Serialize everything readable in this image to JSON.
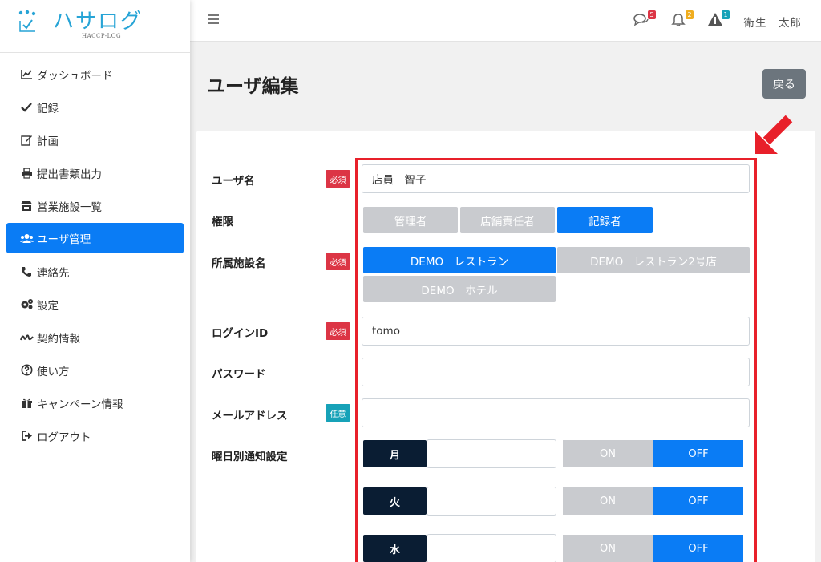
{
  "brand": {
    "title": "ハサログ",
    "subtitle": "HACCP-LOG"
  },
  "sidebar": {
    "items": [
      {
        "label": "ダッシュボード",
        "icon": "chart-line-icon"
      },
      {
        "label": "記録",
        "icon": "check-icon"
      },
      {
        "label": "計画",
        "icon": "edit-icon"
      },
      {
        "label": "提出書類出力",
        "icon": "printer-icon"
      },
      {
        "label": "営業施設一覧",
        "icon": "store-icon"
      },
      {
        "label": "ユーザ管理",
        "icon": "users-icon",
        "active": true
      },
      {
        "label": "連絡先",
        "icon": "phone-icon"
      },
      {
        "label": "設定",
        "icon": "gears-icon"
      },
      {
        "label": "契約情報",
        "icon": "signature-icon"
      },
      {
        "label": "使い方",
        "icon": "question-circle-icon"
      },
      {
        "label": "キャンペーン情報",
        "icon": "gift-icon"
      },
      {
        "label": "ログアウト",
        "icon": "sign-out-icon"
      }
    ]
  },
  "topbar": {
    "messages_badge": "5",
    "notifications_badge": "2",
    "alerts_badge": "1",
    "user_name": "衛生　太郎",
    "colors": {
      "red": "#dc3545",
      "yellow": "#f0ad1e",
      "teal": "#17a2b8"
    }
  },
  "page": {
    "title": "ユーザ編集",
    "back_label": "戻る"
  },
  "form": {
    "username": {
      "label": "ユーザ名",
      "badge": "必須",
      "value": "店員　智子"
    },
    "role": {
      "label": "権限",
      "options": [
        "管理者",
        "店舗責任者",
        "記録者"
      ],
      "selected": "記録者"
    },
    "facility": {
      "label": "所属施設名",
      "badge": "必須",
      "options": [
        "DEMO　レストラン",
        "DEMO　レストラン2号店",
        "DEMO　ホテル"
      ],
      "selected": "DEMO　レストラン"
    },
    "login_id": {
      "label": "ログインID",
      "badge": "必須",
      "value": "tomo"
    },
    "password": {
      "label": "パスワード",
      "value": ""
    },
    "email": {
      "label": "メールアドレス",
      "badge": "任意",
      "value": ""
    },
    "weekday_notify": {
      "label": "曜日別通知設定",
      "on_label": "ON",
      "off_label": "OFF",
      "days": [
        {
          "day": "月",
          "value": "",
          "state": "OFF"
        },
        {
          "day": "火",
          "value": "",
          "state": "OFF"
        },
        {
          "day": "水",
          "value": "",
          "state": "OFF"
        }
      ]
    }
  },
  "colors": {
    "primary": "#0a7cf5",
    "highlight": "#e8202a",
    "day_bg": "#0a1d33"
  }
}
